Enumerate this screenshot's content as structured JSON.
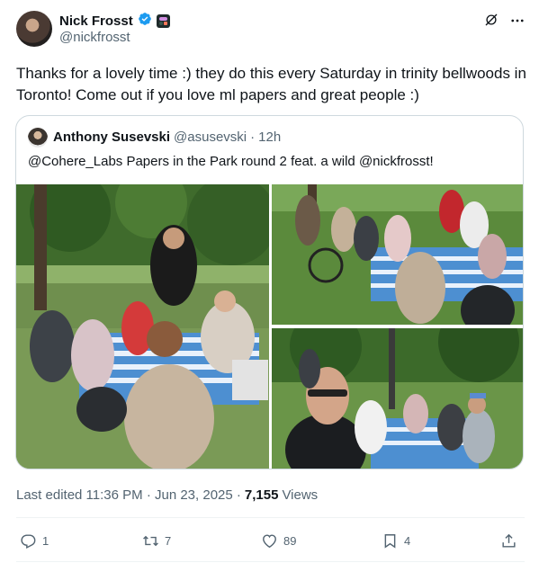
{
  "author": {
    "display_name": "Nick Frosst",
    "handle": "@nickfrosst",
    "verified_icon": "verified-badge-icon",
    "affiliate_icon": "cohere-affiliate-icon"
  },
  "post": {
    "text": "Thanks for a lovely time :) they do this every Saturday in trinity bellwoods in Toronto! Come out if you love ml papers and great people :)"
  },
  "quote": {
    "display_name": "Anthony Susevski",
    "handle": "@asusevski",
    "separator": "·",
    "time": "12h",
    "text": "@Cohere_Labs Papers in the Park round 2 feat. a wild @nickfrosst!"
  },
  "meta": {
    "edited_label": "Last edited 11:36 PM · Jun 23, 2025 ·",
    "views_count": "7,155",
    "views_label": "Views"
  },
  "actions": {
    "replies": "1",
    "reposts": "7",
    "likes": "89",
    "bookmarks": "4"
  },
  "colors": {
    "text": "#0f1419",
    "secondary": "#536471",
    "verified": "#1d9bf0",
    "border": "#cfd9de"
  }
}
